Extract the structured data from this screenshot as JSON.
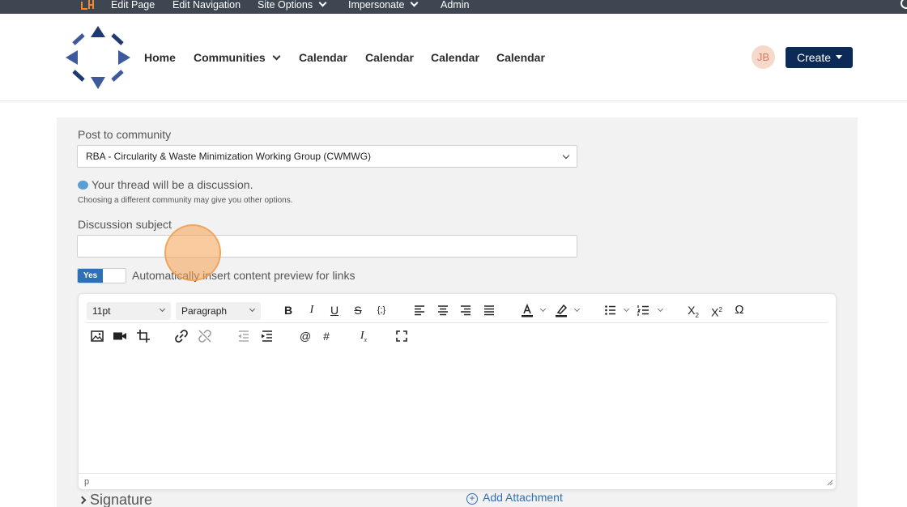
{
  "admin_bar": {
    "items": [
      "Edit Page",
      "Edit Navigation",
      "Site Options",
      "Impersonate",
      "Admin"
    ]
  },
  "header": {
    "nav": [
      "Home",
      "Communities",
      "Calendar",
      "Calendar",
      "Calendar",
      "Calendar"
    ],
    "avatar_initials": "JB",
    "create_label": "Create"
  },
  "form": {
    "community_label": "Post to community",
    "community_value": "RBA - Circularity & Waste Minimization Working Group (CWMWG)",
    "thread_info": "Your thread will be a discussion.",
    "thread_note": "Choosing a different community may give you other options.",
    "subject_label": "Discussion subject",
    "subject_value": "",
    "toggle_state": "Yes",
    "toggle_label": "Automatically insert content preview for links"
  },
  "editor": {
    "font_size": "11pt",
    "block_format": "Paragraph",
    "status_path": "p"
  },
  "footer": {
    "signature_label": "Signature",
    "attachment_label": "Add Attachment"
  },
  "colors": {
    "admin_bar": "#3e4651",
    "primary_button": "#0b2a57",
    "link": "#2f6fb5",
    "logo": "#3e5a9c"
  }
}
